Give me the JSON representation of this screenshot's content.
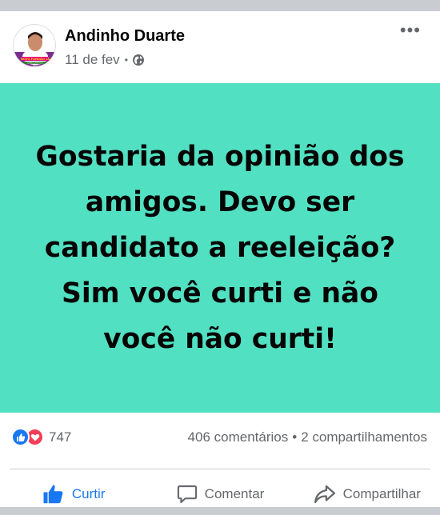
{
  "post": {
    "author": "Andinho Duarte",
    "timestamp": "11 de fev",
    "separator": "•",
    "privacy_icon": "globe-icon",
    "more_icon": "more-options-icon",
    "more_glyph": "•••",
    "avatar": {
      "caption_line1": "NOVO FUNDÃO JÁ",
      "caption_line2": "DEMOCRATICO",
      "caption_line3": "2021"
    },
    "banner": {
      "text": "Gostaria da opinião dos amigos. Devo ser candidato a reeleição? Sim você curti e não você não curti!",
      "background": "#52e0c2"
    },
    "stats": {
      "reaction_icons": [
        "like-reaction-icon",
        "love-reaction-icon"
      ],
      "reaction_count": "747",
      "comments": "406 comentários",
      "separator": "•",
      "shares": "2 compartilhamentos"
    },
    "actions": {
      "like": "Curtir",
      "comment": "Comentar",
      "share": "Compartilhar"
    }
  },
  "colors": {
    "brand_blue": "#1877f2",
    "love_red": "#f33e58",
    "secondary_text": "#65676b"
  }
}
